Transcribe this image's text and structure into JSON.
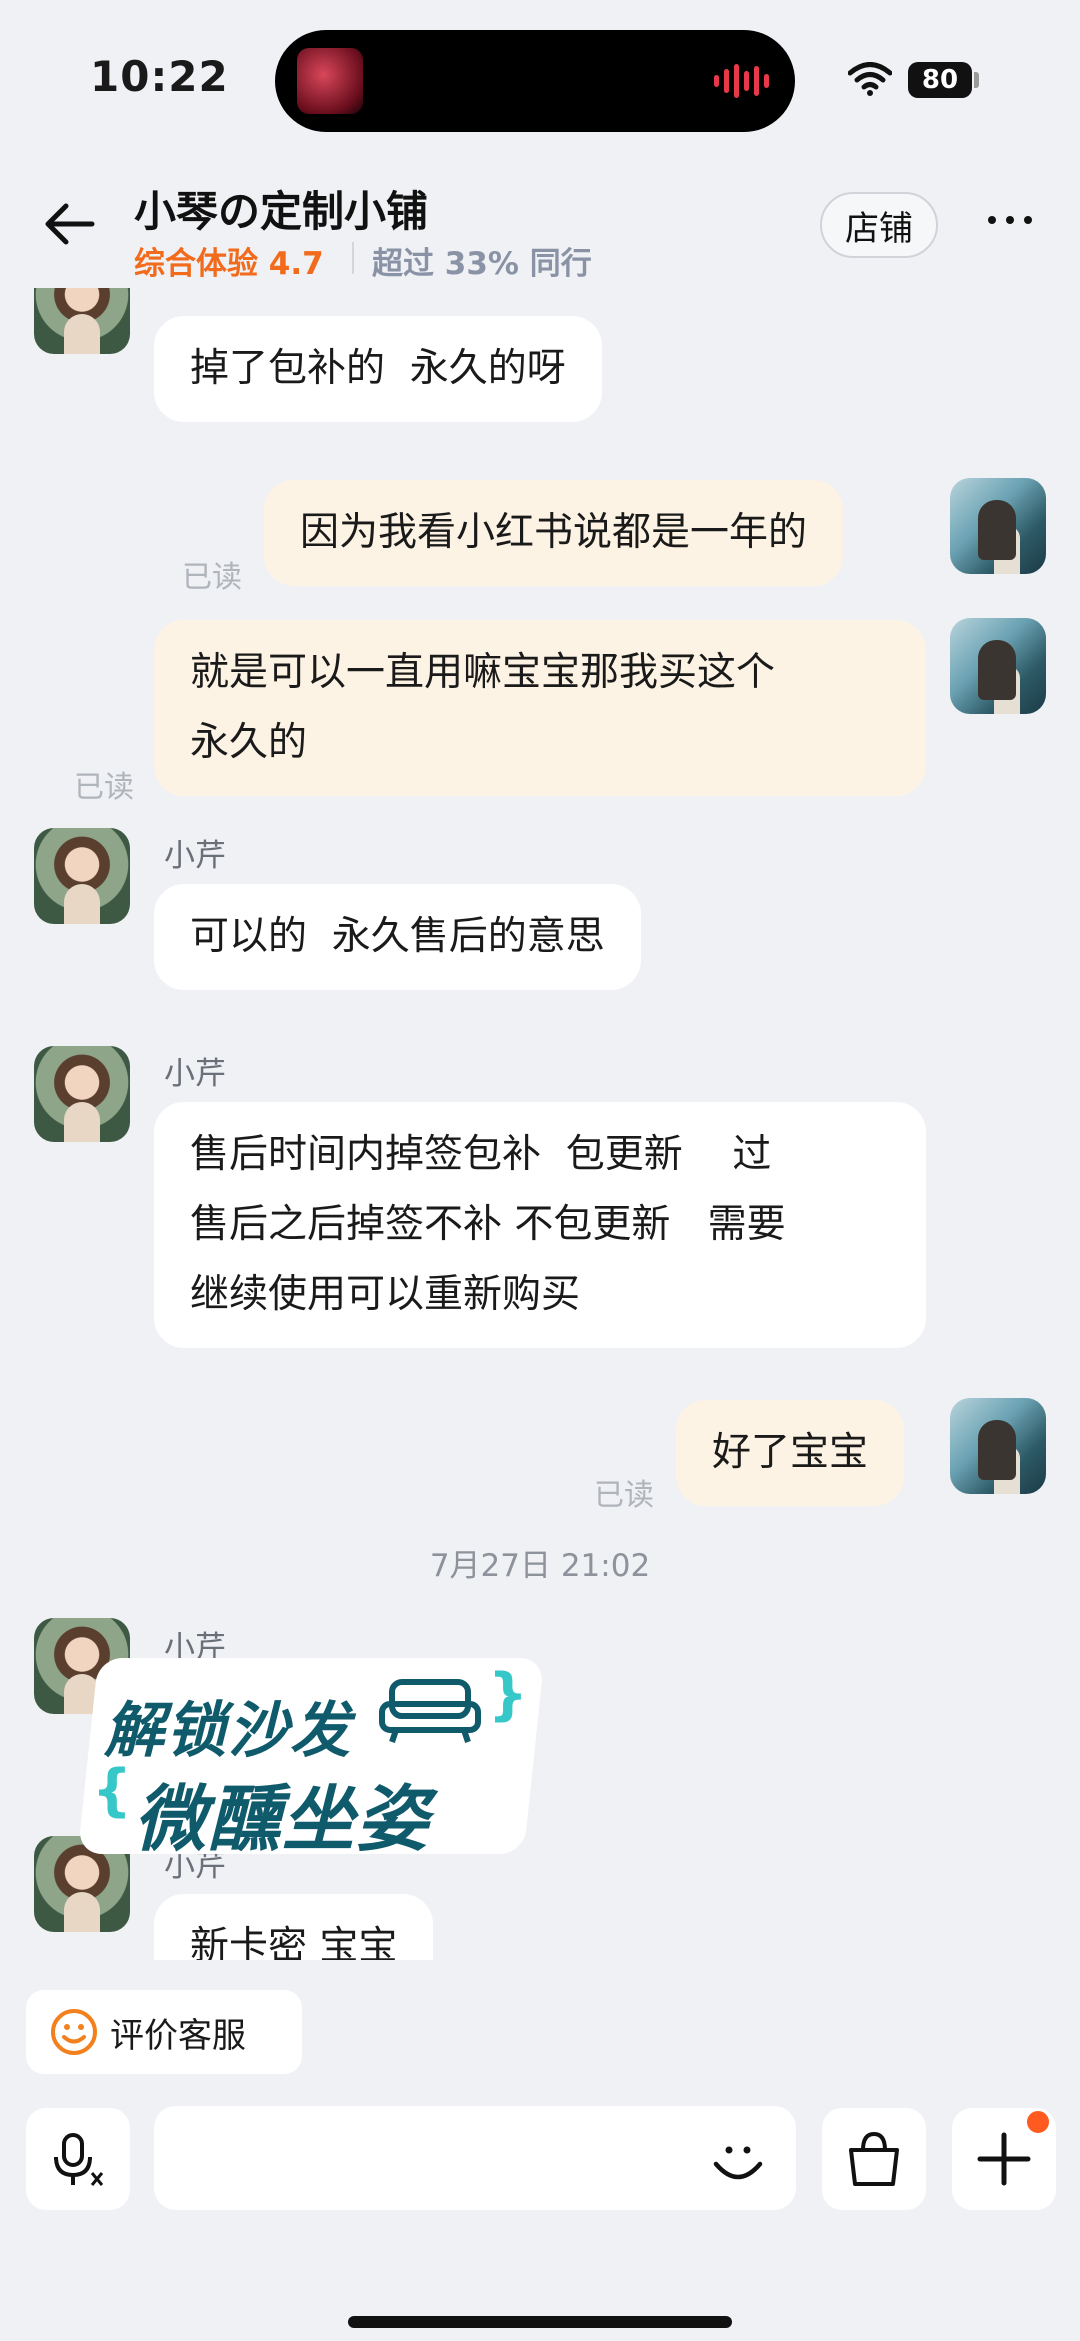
{
  "status": {
    "time": "10:22",
    "battery": "80"
  },
  "header": {
    "title": "小琴の定制小铺",
    "rating": "综合体验 4.7",
    "peer_rank": "超过 33% 同行",
    "store_button": "店铺"
  },
  "chat": {
    "messages": [
      {
        "from": "seller",
        "text": "掉了包补的  永久的呀"
      },
      {
        "from": "me",
        "text": "因为我看小红书说都是一年的",
        "status": "已读"
      },
      {
        "from": "me",
        "text": "就是可以一直用嘛宝宝那我买这个\n永久的",
        "status": "已读"
      },
      {
        "from": "seller",
        "name": "小芹",
        "text": "可以的  永久售后的意思"
      },
      {
        "from": "seller",
        "name": "小芹",
        "text": "售后时间内掉签包补  包更新    过\n售后之后掉签不补 不包更新   需要\n继续使用可以重新购买"
      },
      {
        "from": "me",
        "text": "好了宝宝",
        "status": "已读"
      },
      {
        "from": "seller",
        "name": "小芹",
        "text": ""
      },
      {
        "from": "seller",
        "name": "小芹",
        "text": "新卡密 宝宝"
      }
    ],
    "timestamp": "7月27日 21:02"
  },
  "promo_overlay": {
    "line1": "解锁沙发",
    "line2": "微醺坐姿"
  },
  "bottom": {
    "rate_service": "评价客服"
  },
  "colors": {
    "accent": "#f26a1b",
    "bubble_out": "#fdf3e4",
    "bubble_in": "#ffffff",
    "badge": "#ff5a1f"
  },
  "icons": [
    "back-arrow-icon",
    "more-icon",
    "smile-icon",
    "voice-icon",
    "emoji-icon",
    "shopping-bag-icon",
    "plus-icon",
    "wifi-icon"
  ]
}
